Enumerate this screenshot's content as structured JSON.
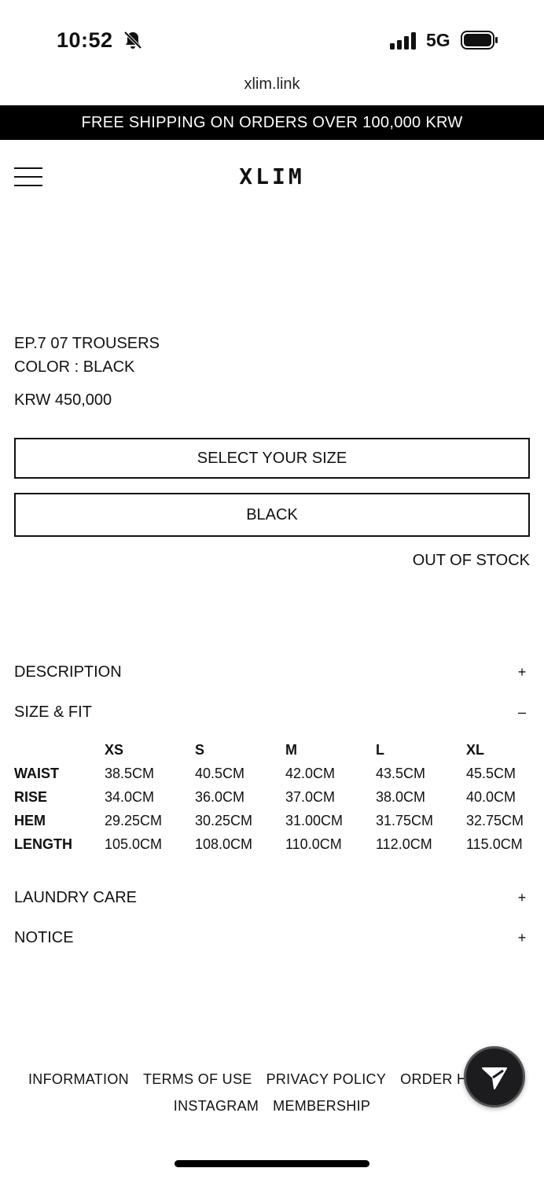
{
  "status_bar": {
    "time": "10:52",
    "network": "5G"
  },
  "browser": {
    "url": "xlim.link"
  },
  "banner": {
    "text": "FREE SHIPPING ON ORDERS OVER 100,000 KRW"
  },
  "header": {
    "brand": "XLIM"
  },
  "product": {
    "name": "EP.7 07 TROUSERS",
    "color_line": "COLOR : BLACK",
    "price": "KRW 450,000",
    "size_select_label": "SELECT YOUR SIZE",
    "color_select_label": "BLACK",
    "stock_status": "OUT OF STOCK"
  },
  "accordion": {
    "description": {
      "label": "DESCRIPTION",
      "toggle": "+"
    },
    "size_fit": {
      "label": "SIZE & FIT",
      "toggle": "–"
    },
    "laundry": {
      "label": "LAUNDRY CARE",
      "toggle": "+"
    },
    "notice": {
      "label": "NOTICE",
      "toggle": "+"
    }
  },
  "size_table": {
    "columns": [
      "XS",
      "S",
      "M",
      "L",
      "XL"
    ],
    "rows": [
      {
        "label": "WAIST",
        "values": [
          "38.5CM",
          "40.5CM",
          "42.0CM",
          "43.5CM",
          "45.5CM"
        ]
      },
      {
        "label": "RISE",
        "values": [
          "34.0CM",
          "36.0CM",
          "37.0CM",
          "38.0CM",
          "40.0CM"
        ]
      },
      {
        "label": "HEM",
        "values": [
          "29.25CM",
          "30.25CM",
          "31.00CM",
          "31.75CM",
          "32.75CM"
        ]
      },
      {
        "label": "LENGTH",
        "values": [
          "105.0CM",
          "108.0CM",
          "110.0CM",
          "112.0CM",
          "115.0CM"
        ]
      }
    ]
  },
  "footer": {
    "links_row1": [
      "INFORMATION",
      "TERMS OF USE",
      "PRIVACY POLICY",
      "ORDER H"
    ],
    "links_row2": [
      "INSTAGRAM",
      "MEMBERSHIP"
    ]
  }
}
